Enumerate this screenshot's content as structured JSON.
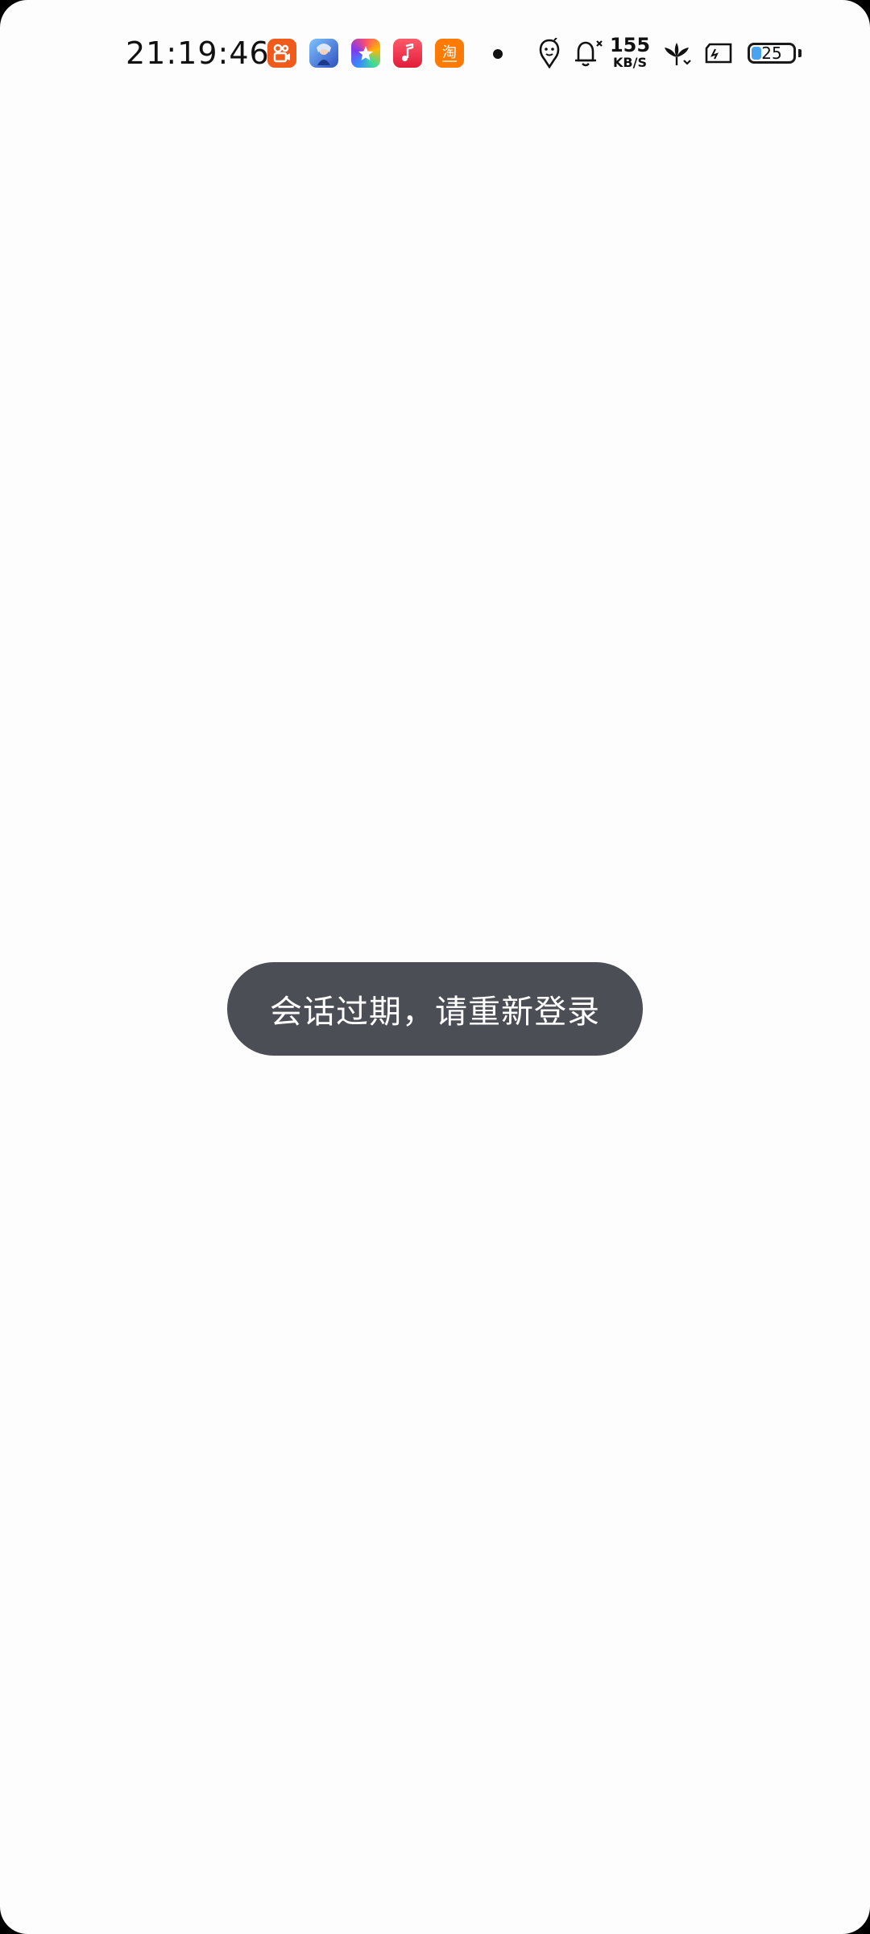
{
  "status_bar": {
    "time": "21:19:46",
    "network_speed": {
      "value": "155",
      "unit": "KB/S"
    },
    "battery": {
      "level": "25",
      "percent": 25
    },
    "notification_icons": [
      {
        "name": "kuaishou-icon",
        "color": "#f05a1a"
      },
      {
        "name": "game-character-icon",
        "color": "#3a6fd8"
      },
      {
        "name": "star-app-icon",
        "color": "#6b5cf0"
      },
      {
        "name": "music-icon",
        "color": "#f23b4f"
      },
      {
        "name": "taobao-icon",
        "color": "#ff6a00"
      }
    ],
    "system_icons": [
      "assistant-icon",
      "alarm-muted-icon",
      "flower-icon",
      "sd-card-icon"
    ]
  },
  "toast": {
    "message": "会话过期，请重新登录",
    "background": "#4b4e55"
  },
  "colors": {
    "screen_background": "#fdfdfd"
  }
}
